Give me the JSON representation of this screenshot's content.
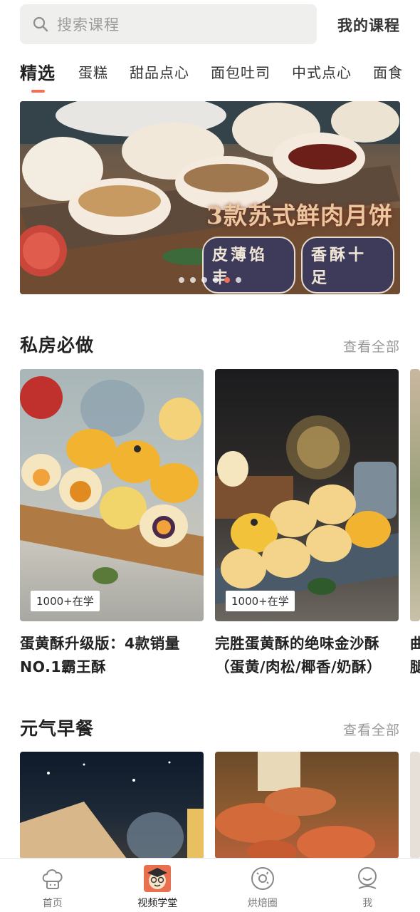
{
  "search": {
    "placeholder": "搜索课程"
  },
  "header": {
    "my_courses": "我的课程"
  },
  "tabs": [
    {
      "label": "精选",
      "active": true
    },
    {
      "label": "蛋糕"
    },
    {
      "label": "甜品点心"
    },
    {
      "label": "面包吐司"
    },
    {
      "label": "中式点心"
    },
    {
      "label": "面食"
    }
  ],
  "banner": {
    "title": "3款苏式鲜肉月饼",
    "subtitle_left": "皮薄馅丰",
    "subtitle_right": "香酥十足",
    "dots_count": 6,
    "active_dot": 4
  },
  "sections": [
    {
      "title": "私房必做",
      "see_all": "查看全部",
      "cards": [
        {
          "badge": "1000+在学",
          "title": "蛋黄酥升级版：4款销量NO.1霸王酥"
        },
        {
          "badge": "1000+在学",
          "title": "完胜蛋黄酥的绝味金沙酥（蛋黄/肉松/椰香/奶酥）"
        },
        {
          "badge": "",
          "title": "曲腿"
        }
      ]
    },
    {
      "title": "元气早餐",
      "see_all": "查看全部",
      "cards": [
        {},
        {}
      ]
    }
  ],
  "bottom_nav": [
    {
      "label": "首页",
      "icon": "chef-hat-icon"
    },
    {
      "label": "视频学堂",
      "icon": "teacher-avatar-icon",
      "active": true
    },
    {
      "label": "烘焙圈",
      "icon": "donut-icon"
    },
    {
      "label": "我",
      "icon": "smiley-face-icon"
    }
  ],
  "colors": {
    "accent": "#f0705a",
    "muted": "#999999",
    "search_bg": "#efefee"
  }
}
